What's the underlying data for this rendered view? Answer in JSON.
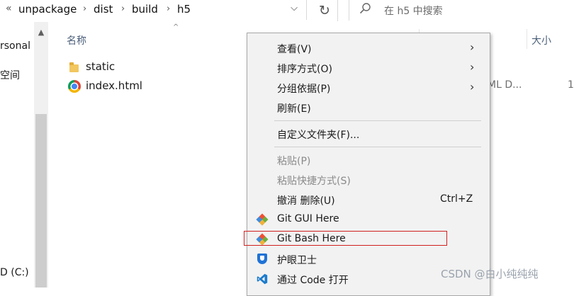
{
  "address_bar": {
    "back_glyph": "«",
    "breadcrumb": [
      "unpackage",
      "dist",
      "build",
      "h5"
    ],
    "separator": "›",
    "dropdown_glyph": "⌵",
    "refresh_glyph": "↻"
  },
  "search": {
    "placeholder": "在 h5 中搜索",
    "icon": "search-icon"
  },
  "nav_pane": {
    "items": [
      "rsonal",
      "空间",
      "D (C:)"
    ],
    "scroll_up_glyph": "▲"
  },
  "file_list": {
    "columns": {
      "name": "名称",
      "size": "大小"
    },
    "sort_glyph": "^",
    "rows": [
      {
        "name": "static",
        "icon": "folder-icon",
        "type": "",
        "size": ""
      },
      {
        "name": "index.html",
        "icon": "chrome-icon",
        "type": "ML D...",
        "size": "1"
      }
    ]
  },
  "context_menu": {
    "submenu_glyph": "›",
    "items": [
      {
        "label": "查看(V)",
        "submenu": true
      },
      {
        "label": "排序方式(O)",
        "submenu": true
      },
      {
        "label": "分组依据(P)",
        "submenu": true
      },
      {
        "label": "刷新(E)"
      },
      {
        "label": "自定义文件夹(F)..."
      },
      {
        "label": "粘贴(P)",
        "disabled": true
      },
      {
        "label": "粘贴快捷方式(S)",
        "disabled": true
      },
      {
        "label": "撤消 删除(U)",
        "shortcut": "Ctrl+Z"
      },
      {
        "label": "Git GUI Here",
        "icon": "git-gui-icon"
      },
      {
        "label": "Git Bash Here",
        "icon": "git-bash-icon",
        "highlighted": true
      },
      {
        "label": "护眼卫士",
        "icon": "shield-icon"
      },
      {
        "label": "通过 Code 打开",
        "icon": "vscode-icon"
      }
    ],
    "highlight_color": "#d02020"
  },
  "watermark": "CSDN @白小纯纯纯"
}
